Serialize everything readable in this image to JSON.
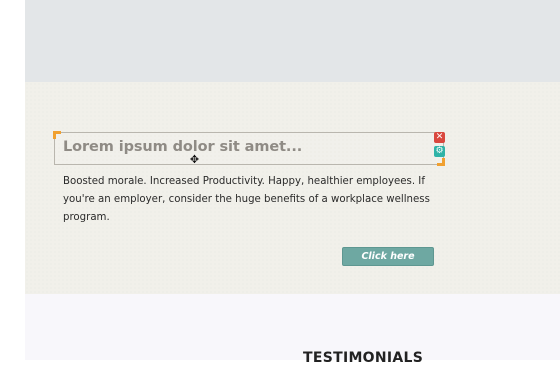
{
  "editor": {
    "heading_text": "Lorem ipsum dolor sit amet...",
    "delete_icon": "close-icon",
    "settings_icon": "gear-icon",
    "cursor_icon": "move-cursor-icon"
  },
  "content": {
    "paragraph": "Boosted morale. Increased Productivity. Happy, healthier employees. If you're an employer, consider the huge benefits of a workplace wellness program.",
    "button_label": "Click here"
  },
  "testimonials": {
    "title": "TESTIMONIALS"
  },
  "colors": {
    "top_band": "#e3e6e8",
    "content_band": "#f1f0ea",
    "button": "#6ea8a2",
    "delete": "#d9473e",
    "settings": "#2fb3a7",
    "handle": "#f0a030"
  }
}
